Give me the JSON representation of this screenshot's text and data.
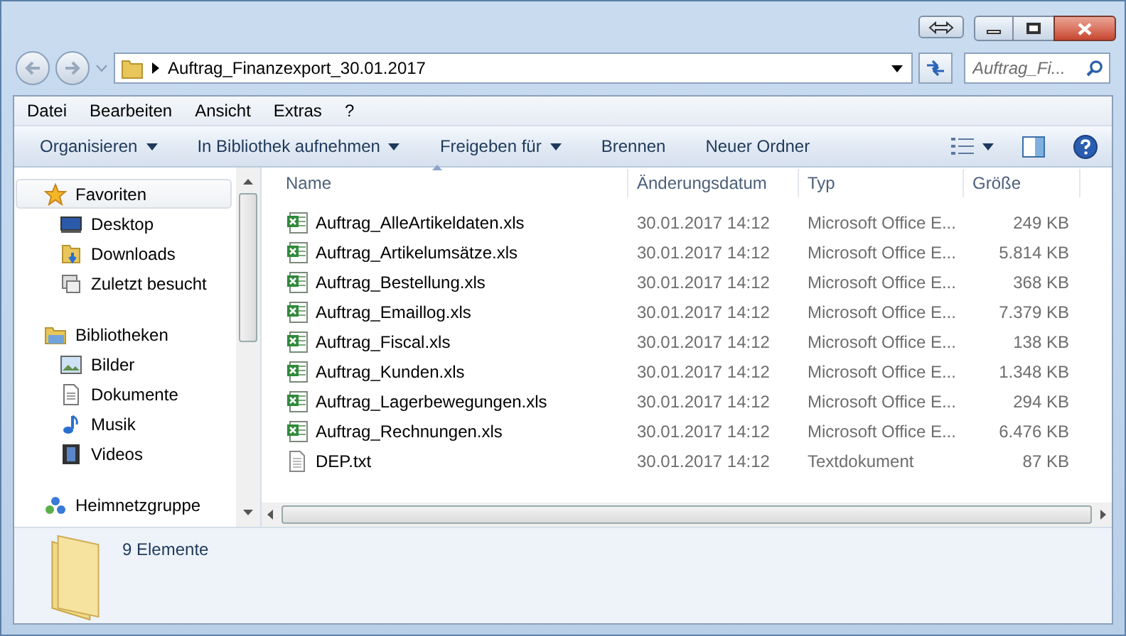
{
  "address": {
    "path": "Auftrag_Finanzexport_30.01.2017",
    "search_placeholder": "Auftrag_Fi..."
  },
  "menu": [
    "Datei",
    "Bearbeiten",
    "Ansicht",
    "Extras",
    "?"
  ],
  "toolbar": [
    {
      "label": "Organisieren",
      "dropdown": true
    },
    {
      "label": "In Bibliothek aufnehmen",
      "dropdown": true
    },
    {
      "label": "Freigeben für",
      "dropdown": true
    },
    {
      "label": "Brennen",
      "dropdown": false
    },
    {
      "label": "Neuer Ordner",
      "dropdown": false
    }
  ],
  "sidebar": [
    {
      "label": "Favoriten",
      "kind": "star",
      "selected": true,
      "children": [
        {
          "label": "Desktop",
          "kind": "desktop",
          "selected": false
        },
        {
          "label": "Downloads",
          "kind": "downloads",
          "selected": false
        },
        {
          "label": "Zuletzt besucht",
          "kind": "recent",
          "selected": false
        }
      ]
    },
    {
      "label": "Bibliotheken",
      "kind": "library",
      "selected": false,
      "children": [
        {
          "label": "Bilder",
          "kind": "pictures",
          "selected": false
        },
        {
          "label": "Dokumente",
          "kind": "documents",
          "selected": false
        },
        {
          "label": "Musik",
          "kind": "music",
          "selected": false
        },
        {
          "label": "Videos",
          "kind": "videos",
          "selected": false
        }
      ]
    },
    {
      "label": "Heimnetzgruppe",
      "kind": "homegroup",
      "selected": false
    }
  ],
  "columns": [
    {
      "label": "Name",
      "sorted": true
    },
    {
      "label": "Änderungsdatum"
    },
    {
      "label": "Typ"
    },
    {
      "label": "Größe"
    }
  ],
  "files": [
    {
      "name": "Auftrag_AlleArtikeldaten.xls",
      "kind": "xls",
      "date": "30.01.2017 14:12",
      "type": "Microsoft Office E...",
      "size": "249 KB"
    },
    {
      "name": "Auftrag_Artikelumsätze.xls",
      "kind": "xls",
      "date": "30.01.2017 14:12",
      "type": "Microsoft Office E...",
      "size": "5.814 KB"
    },
    {
      "name": "Auftrag_Bestellung.xls",
      "kind": "xls",
      "date": "30.01.2017 14:12",
      "type": "Microsoft Office E...",
      "size": "368 KB"
    },
    {
      "name": "Auftrag_Emaillog.xls",
      "kind": "xls",
      "date": "30.01.2017 14:12",
      "type": "Microsoft Office E...",
      "size": "7.379 KB"
    },
    {
      "name": "Auftrag_Fiscal.xls",
      "kind": "xls",
      "date": "30.01.2017 14:12",
      "type": "Microsoft Office E...",
      "size": "138 KB"
    },
    {
      "name": "Auftrag_Kunden.xls",
      "kind": "xls",
      "date": "30.01.2017 14:12",
      "type": "Microsoft Office E...",
      "size": "1.348 KB"
    },
    {
      "name": "Auftrag_Lagerbewegungen.xls",
      "kind": "xls",
      "date": "30.01.2017 14:12",
      "type": "Microsoft Office E...",
      "size": "294 KB"
    },
    {
      "name": "Auftrag_Rechnungen.xls",
      "kind": "xls",
      "date": "30.01.2017 14:12",
      "type": "Microsoft Office E...",
      "size": "6.476 KB"
    },
    {
      "name": "DEP.txt",
      "kind": "txt",
      "date": "30.01.2017 14:12",
      "type": "Textdokument",
      "size": "87 KB"
    }
  ],
  "details": {
    "count": "9 Elemente"
  }
}
